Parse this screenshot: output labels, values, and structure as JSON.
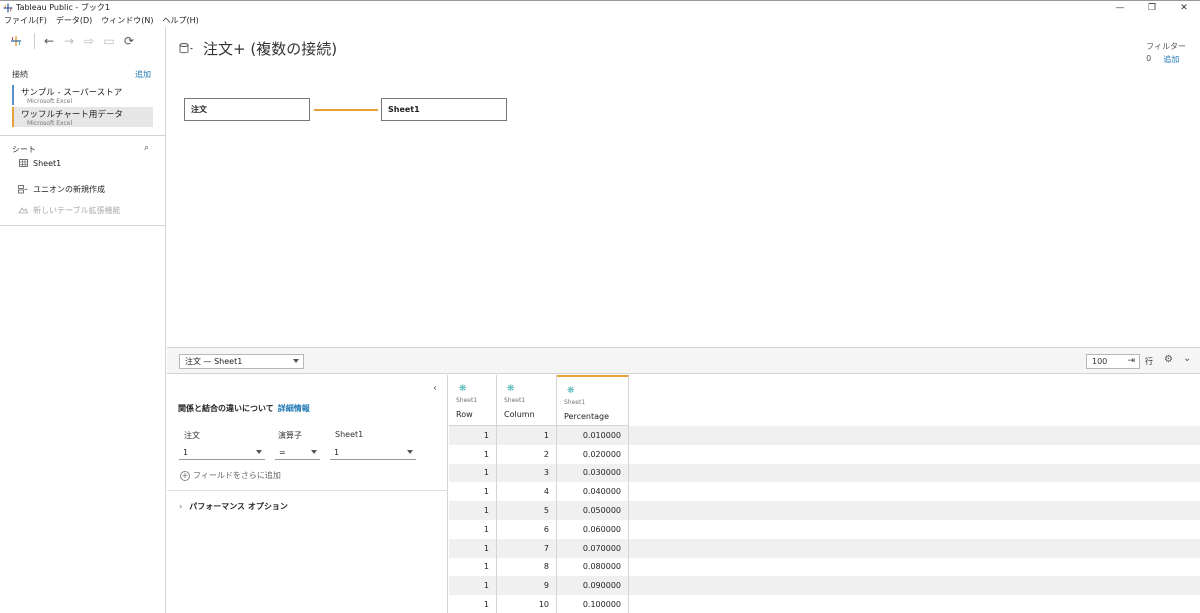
{
  "window": {
    "title": "Tableau Public - ブック1",
    "minimize": "—",
    "restore": "❐",
    "close": "✕"
  },
  "menu": [
    "ファイル(F)",
    "データ(D)",
    "ウィンドウ(N)",
    "ヘルプ(H)"
  ],
  "left_panel": {
    "connections_label": "接続",
    "add_label": "追加",
    "connections": [
      {
        "name": "サンプル - スーパーストア",
        "type": "Microsoft Excel"
      },
      {
        "name": "ワッフルチャート用データ",
        "type": "Microsoft Excel"
      }
    ],
    "sheets_label": "シート",
    "sheets": [
      "Sheet1"
    ],
    "new_union": "ユニオンの新規作成",
    "new_table_extension": "新しいテーブル拡張機能"
  },
  "canvas": {
    "datasource_title": "注文+ (複数の接続)",
    "filters_label": "フィルター",
    "filters_count": "0",
    "filters_add": "追加",
    "tables": [
      "注文",
      "Sheet1"
    ]
  },
  "bottom_bar": {
    "join_select": "注文 — Sheet1",
    "rows_value": "100",
    "rows_label": "行"
  },
  "join_panel": {
    "info_text": "関係と結合の違いについて",
    "info_link": "詳細情報",
    "left_col_label": "注文",
    "operator_label": "演算子",
    "right_col_label": "Sheet1",
    "left_value": "1",
    "operator_value": "=",
    "right_value": "1",
    "add_field": "フィールドをさらに追加",
    "performance": "パフォーマンス オプション"
  },
  "grid": {
    "columns": [
      {
        "source": "Sheet1",
        "name": "Row"
      },
      {
        "source": "Sheet1",
        "name": "Column"
      },
      {
        "source": "Sheet1",
        "name": "Percentage"
      }
    ],
    "rows": [
      [
        "1",
        "1",
        "0.010000"
      ],
      [
        "1",
        "2",
        "0.020000"
      ],
      [
        "1",
        "3",
        "0.030000"
      ],
      [
        "1",
        "4",
        "0.040000"
      ],
      [
        "1",
        "5",
        "0.050000"
      ],
      [
        "1",
        "6",
        "0.060000"
      ],
      [
        "1",
        "7",
        "0.070000"
      ],
      [
        "1",
        "8",
        "0.080000"
      ],
      [
        "1",
        "9",
        "0.090000"
      ],
      [
        "1",
        "10",
        "0.100000"
      ]
    ]
  },
  "colors": {
    "accent_orange": "#e8a13a",
    "link_blue": "#1f77b4",
    "field_teal": "#4cb3b0"
  }
}
